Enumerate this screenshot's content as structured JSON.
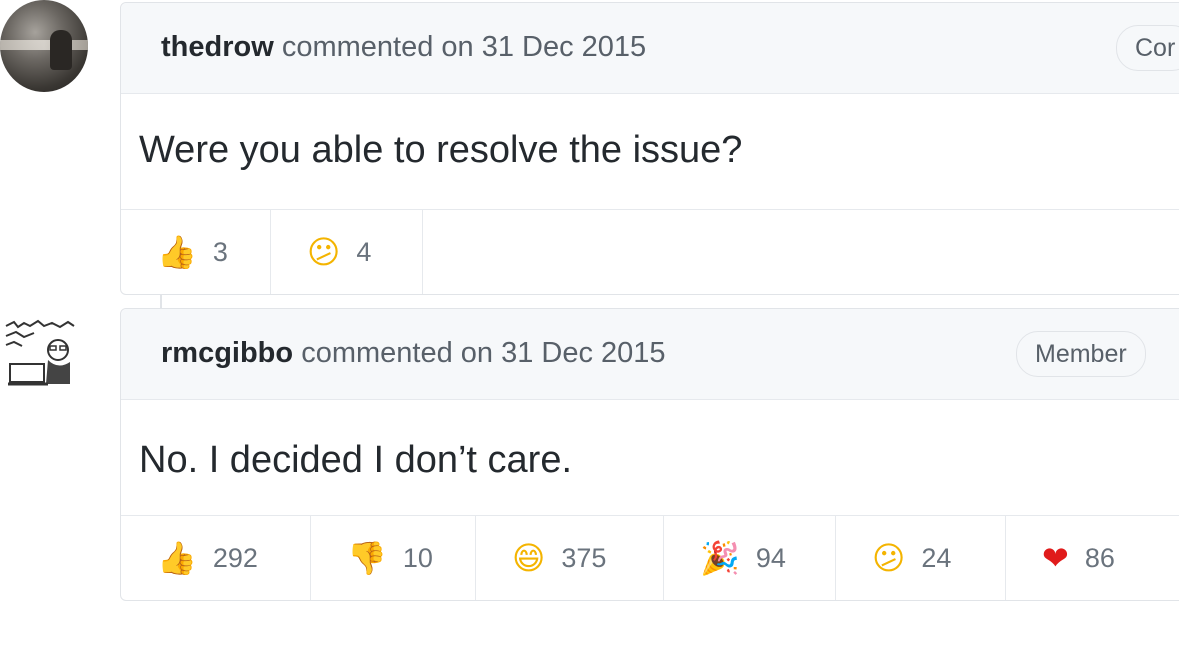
{
  "comments": [
    {
      "author": "thedrow",
      "action": "commented on 31 Dec 2015",
      "badge": "Cor",
      "body": "Were you able to resolve the issue?",
      "reactions": [
        {
          "icon": "thumbs-up-icon",
          "glyph": "👍",
          "count": "3"
        },
        {
          "icon": "confused-face-icon",
          "glyph": "😕",
          "count": "4"
        }
      ]
    },
    {
      "author": "rmcgibbo",
      "action": "commented on 31 Dec 2015",
      "badge": "Member",
      "body": "No. I decided I don’t care.",
      "reactions": [
        {
          "icon": "thumbs-up-icon",
          "glyph": "👍",
          "count": "292"
        },
        {
          "icon": "thumbs-down-icon",
          "glyph": "👎",
          "count": "10"
        },
        {
          "icon": "laugh-icon",
          "glyph": "😄",
          "count": "375"
        },
        {
          "icon": "hooray-icon",
          "glyph": "🎉",
          "count": "94"
        },
        {
          "icon": "confused-face-icon",
          "glyph": "😕",
          "count": "24"
        },
        {
          "icon": "heart-icon",
          "glyph": "❤",
          "count": "86"
        }
      ]
    }
  ]
}
